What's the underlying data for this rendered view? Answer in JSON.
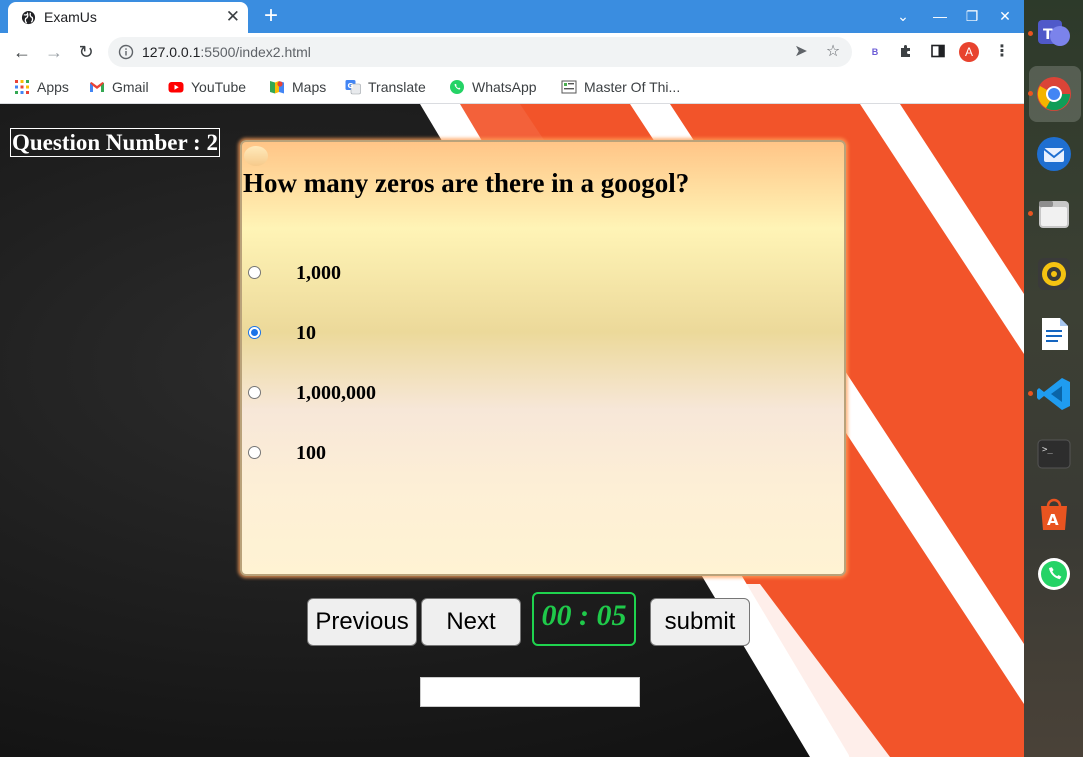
{
  "browser": {
    "tab_title": "ExamUs",
    "tab_close": "✕",
    "new_tab": "+",
    "url_host": "127.0.0.1",
    "url_path": ":5500/index2.html",
    "profile_initial": "A",
    "window_controls": {
      "dropdown": "⌄",
      "minimize": "—",
      "restore": "❐",
      "close": "✕"
    }
  },
  "bookmarks": [
    {
      "label": "Apps",
      "icon": "apps-grid-icon"
    },
    {
      "label": "Gmail",
      "icon": "gmail-icon"
    },
    {
      "label": "YouTube",
      "icon": "youtube-icon"
    },
    {
      "label": "Maps",
      "icon": "maps-icon"
    },
    {
      "label": "Translate",
      "icon": "translate-icon"
    },
    {
      "label": "WhatsApp",
      "icon": "whatsapp-icon"
    },
    {
      "label": "Master Of Thi...",
      "icon": "site-icon"
    }
  ],
  "exam": {
    "question_number_label": "Question Number : 2",
    "question": "How many zeros are there in a googol?",
    "options": [
      {
        "label": "1,000",
        "selected": false
      },
      {
        "label": "10",
        "selected": true
      },
      {
        "label": "1,000,000",
        "selected": false
      },
      {
        "label": "100",
        "selected": false
      }
    ],
    "previous_label": "Previous",
    "next_label": "Next",
    "timer": "00 : 05",
    "submit_label": "submit",
    "result_text": ""
  },
  "colors": {
    "tabstrip": "#3a8de0",
    "stripe_orange": "#f2542a",
    "timer_green": "#1fc94a",
    "radio_selected": "#1a73e8"
  },
  "dock": [
    {
      "name": "teams-icon",
      "running": true
    },
    {
      "name": "chrome-icon",
      "running": true
    },
    {
      "name": "thunderbird-icon",
      "running": false
    },
    {
      "name": "files-icon",
      "running": true
    },
    {
      "name": "rhythmbox-icon",
      "running": false
    },
    {
      "name": "writer-icon",
      "running": false
    },
    {
      "name": "vscode-icon",
      "running": true
    },
    {
      "name": "terminal-icon",
      "running": false
    },
    {
      "name": "app-center-icon",
      "running": false
    },
    {
      "name": "whatsapp-icon",
      "running": false
    }
  ]
}
